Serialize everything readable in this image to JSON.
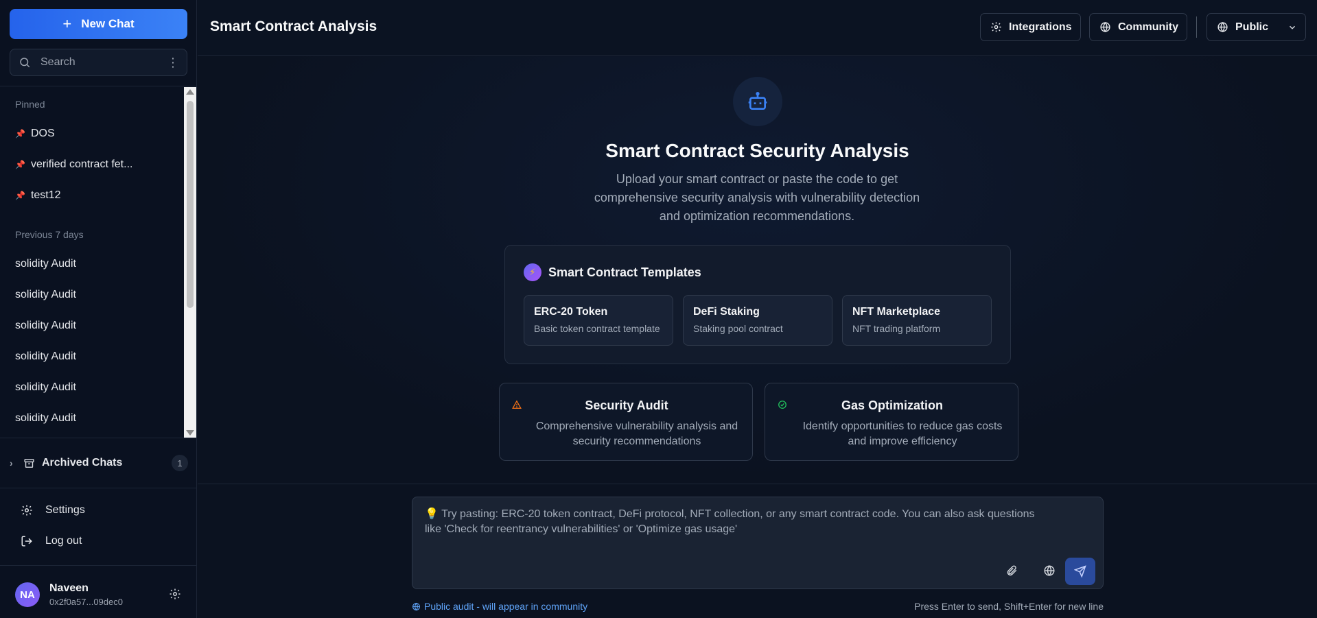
{
  "sidebar": {
    "new_chat_label": "New Chat",
    "search_placeholder": "Search",
    "pinned_label": "Pinned",
    "pinned": [
      {
        "label": "DOS"
      },
      {
        "label": "verified contract fet..."
      },
      {
        "label": "test12"
      }
    ],
    "recent_label": "Previous 7 days",
    "recent": [
      {
        "label": "solidity Audit"
      },
      {
        "label": "solidity Audit"
      },
      {
        "label": "solidity Audit"
      },
      {
        "label": "solidity Audit"
      },
      {
        "label": "solidity Audit"
      },
      {
        "label": "solidity Audit"
      }
    ],
    "archived_label": "Archived Chats",
    "archived_count": "1",
    "settings_label": "Settings",
    "logout_label": "Log out",
    "user": {
      "initials": "NA",
      "name": "Naveen",
      "address": "0x2f0a57...09dec0"
    }
  },
  "header": {
    "title": "Smart Contract Analysis",
    "integrations_label": "Integrations",
    "community_label": "Community",
    "visibility_label": "Public"
  },
  "hero": {
    "title": "Smart Contract Security Analysis",
    "subtitle": "Upload your smart contract or paste the code to get comprehensive security analysis with vulnerability detection and optimization recommendations."
  },
  "templates": {
    "heading": "Smart Contract Templates",
    "items": [
      {
        "title": "ERC-20 Token",
        "desc": "Basic token contract template"
      },
      {
        "title": "DeFi Staking",
        "desc": "Staking pool contract"
      },
      {
        "title": "NFT Marketplace",
        "desc": "NFT trading platform"
      }
    ]
  },
  "features": [
    {
      "title": "Security Audit",
      "desc": "Comprehensive vulnerability analysis and security recommendations"
    },
    {
      "title": "Gas Optimization",
      "desc": "Identify opportunities to reduce gas costs and improve efficiency"
    }
  ],
  "composer": {
    "placeholder": "💡 Try pasting: ERC-20 token contract, DeFi protocol, NFT collection, or any smart contract code. You can also ask questions like 'Check for reentrancy vulnerabilities' or 'Optimize gas usage'",
    "public_note": "Public audit - will appear in community",
    "hint": "Press Enter to send, Shift+Enter for new line"
  },
  "colors": {
    "accent": "#3b82f6",
    "warning": "#f97316",
    "success": "#22c55e"
  }
}
